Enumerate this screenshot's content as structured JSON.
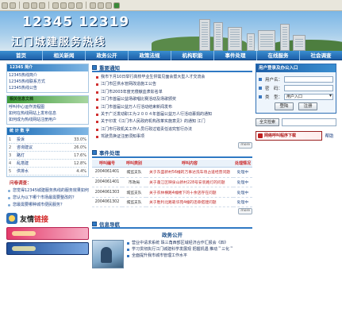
{
  "banner": {
    "hotline_numbers": "12345 12319",
    "title": "江门城建服务热线"
  },
  "nav": [
    "首页",
    "相关新闻",
    "政务公开",
    "政策法规",
    "机构职能",
    "事件处理",
    "在线服务",
    "社会调查"
  ],
  "left": {
    "intro": {
      "heading": "12345 简介",
      "links": [
        "12345热线简介",
        "12345热线联系方式",
        "12345热线公告"
      ]
    },
    "docs": {
      "heading": "相关信息文档",
      "links": [
        "呼叫中心运作流程图",
        "如何在热线网站上发布信息",
        "如何成为热线网站注册用户"
      ]
    },
    "stats": {
      "heading": "统 计 数 字",
      "rows": [
        {
          "rank": "1",
          "label": "投诉",
          "pct": "33.0%",
          "value": 33.0
        },
        {
          "rank": "2",
          "label": "咨询建议",
          "pct": "26.0%",
          "value": 26.0
        },
        {
          "rank": "3",
          "label": "路灯",
          "pct": "17.6%",
          "value": 17.6
        },
        {
          "rank": "4",
          "label": "乱搭建",
          "pct": "12.8%",
          "value": 12.8
        },
        {
          "rank": "5",
          "label": "供排水",
          "pct": "4.4%",
          "value": 4.4
        }
      ]
    },
    "questions": {
      "heading": "问卷调查：",
      "items": [
        "您觉得12345城建服务热线的服务效果如何？",
        "您认为以下哪个市场最需要整改的？",
        "您最需要哪种城市便民服务？"
      ]
    },
    "friend_links": {
      "text": "友情",
      "red": "链接"
    }
  },
  "middle": {
    "notices": {
      "heading": "重要通知",
      "items": [
        "我市下月10日举行高校毕业生供需见面会暨大型人才交流会",
        "江门市区供水管网改造施工公告",
        "江门市2003年度无偿献血表彰名单",
        "江门市首届公益场歌唱比赛活动及场歌颁奖",
        "江门市首届公益万人行活动结束新闻发布",
        "关于广泛发动职工为２００４年首届公益万人行活动募捐的通知",
        "关于印发《江门市人民政府机构改革实施意见》的通知 江门",
        "江门市行政机关工作人员行政过错责任追究暂行办法",
        "驾驶员换证注册须知事项"
      ],
      "more": "more"
    },
    "events": {
      "heading": "事件处理",
      "columns": [
        "呼叫编号",
        "呼叫类别",
        "呼叫内容",
        "处理情况"
      ],
      "rows": [
        {
          "id": "2004061401",
          "type": "城监支队",
          "content": "关于东盛新村56幢的万事达洗车场占道经营问题",
          "status": "处理中"
        },
        {
          "id": "2004061401",
          "type": "市政局",
          "content": "关于蓬江区映泉山新村228号安装路灯的问题",
          "status": "处理中"
        },
        {
          "id": "2004061303",
          "type": "城监支队",
          "content": "关于农林横路4幢楼下的十余店存在问题",
          "status": "处理中"
        },
        {
          "id": "2004061302",
          "type": "城监支队",
          "content": "关于胜利北路靠华苑4幢的违章搭建问题",
          "status": "处理中"
        }
      ],
      "more": "more"
    },
    "guide": {
      "heading": "信息导航",
      "subheading": "政务公开",
      "items": [
        "营业中请求系统 珠三角西部区域经济合作汇报会《四》",
        "学习贯彻执行江门城建科学发展观 把握机遇 推动＂三化＂",
        "全面提升我市城市管理工作水平"
      ]
    }
  },
  "right": {
    "login": {
      "heading": "用户登录及办公入口",
      "username_label": "用户名：",
      "password_label": "密　码：",
      "type_label": "类　型：",
      "type_value": "用户入口",
      "login_btn": "登陆",
      "register_btn": "注册"
    },
    "search_btn": "全文检索",
    "download": "网络呼叫程序下载",
    "help": "帮助"
  },
  "colors": {
    "nav_blue": "#1d5fa8",
    "accent_red": "#d02020",
    "link_blue": "#1a3e80"
  }
}
